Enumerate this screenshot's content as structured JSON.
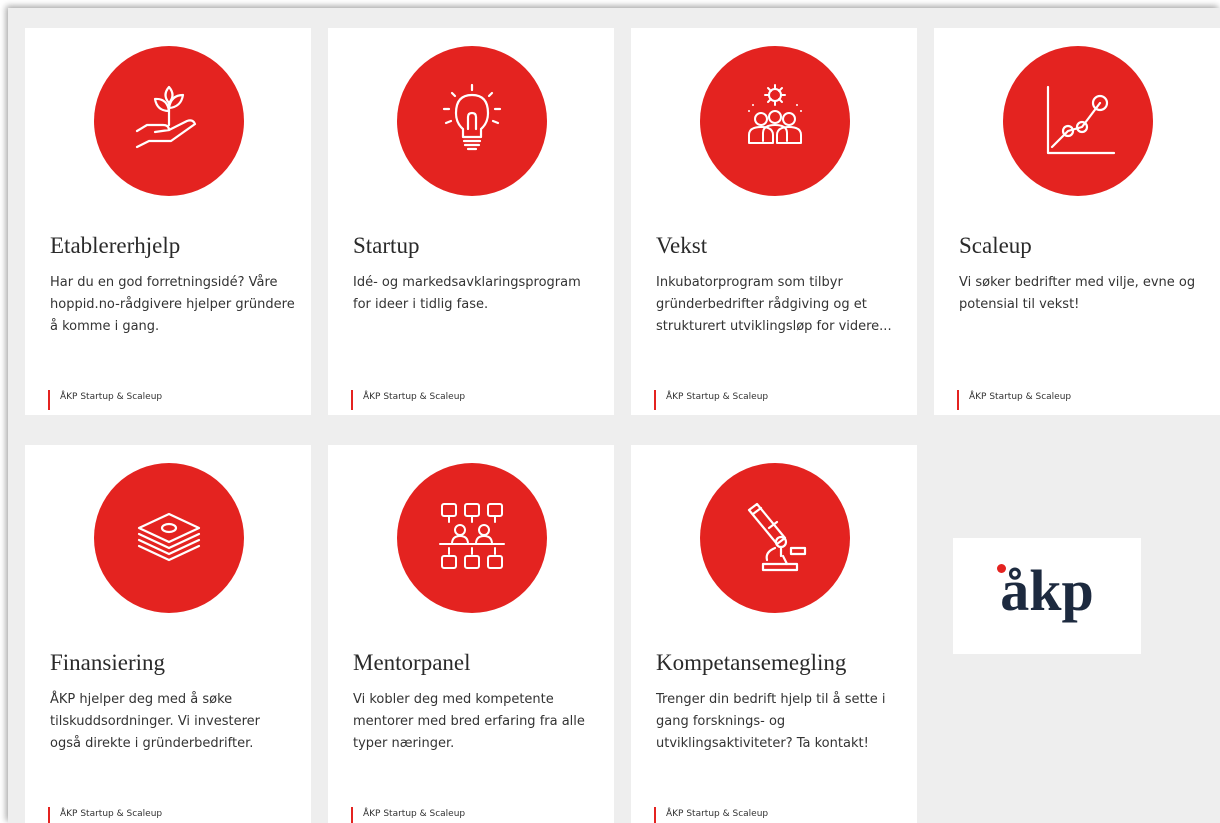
{
  "accent": "#e42320",
  "cards": [
    {
      "title": "Etablererhjelp",
      "description": "Har du en god forretningsidé? Våre hoppid.no-rådgivere hjelper gründere å komme i gang.",
      "tag": "ÅKP Startup & Scaleup",
      "icon": "plant-in-hand-icon"
    },
    {
      "title": "Startup",
      "description": "Idé- og markedsavklaringsprogram for ideer i tidlig fase.",
      "tag": "ÅKP Startup & Scaleup",
      "icon": "lightbulb-icon"
    },
    {
      "title": "Vekst",
      "description": "Inkubatorprogram som tilbyr gründerbedrifter rådgiving og et strukturert utviklingsløp for videre...",
      "tag": "ÅKP Startup & Scaleup",
      "icon": "team-gear-icon"
    },
    {
      "title": "Scaleup",
      "description": "Vi søker bedrifter med vilje, evne og potensial til vekst!",
      "tag": "ÅKP Startup & Scaleup",
      "icon": "growth-chart-icon"
    },
    {
      "title": "Finansiering",
      "description": "ÅKP hjelper deg med å søke tilskuddsordninger. Vi investerer også direkte i gründerbedrifter.",
      "tag": "ÅKP Startup & Scaleup",
      "icon": "money-stack-icon"
    },
    {
      "title": "Mentorpanel",
      "description": "Vi kobler deg med kompetente mentorer med bred erfaring fra alle typer næringer.",
      "tag": "ÅKP Startup & Scaleup",
      "icon": "mentor-network-icon"
    },
    {
      "title": "Kompetansemegling",
      "description": "Trenger din bedrift hjelp til å sette i gang forsknings- og utviklingsaktiviteter? Ta kontakt!",
      "tag": "ÅKP Startup & Scaleup",
      "icon": "microscope-icon"
    }
  ],
  "logo": {
    "text": "åkp"
  }
}
